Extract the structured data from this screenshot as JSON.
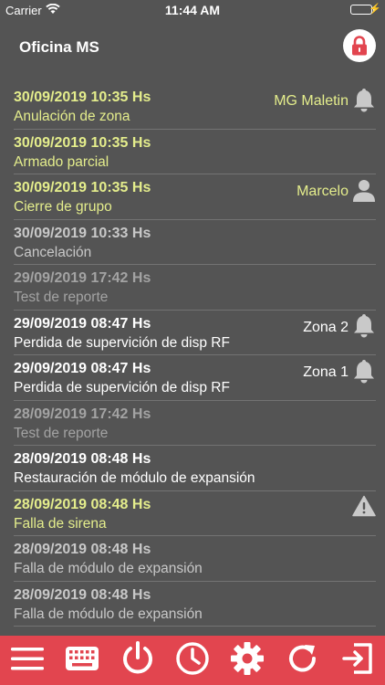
{
  "status": {
    "carrier": "Carrier",
    "time": "11:44 AM",
    "battery_level": 1.0
  },
  "header": {
    "title": "Oficina MS",
    "lock_icon": "lock-icon",
    "lock_color": "#e2454f"
  },
  "colors": {
    "background": "#545454",
    "toolbar": "#e2454f",
    "yellow": "#e4ed8c"
  },
  "events": [
    {
      "date": "30/09/2019 10:35 Hs",
      "desc": "Anulación de zona",
      "color": "yellow",
      "right_label": "MG Maletin",
      "icon": "bell-icon"
    },
    {
      "date": "30/09/2019 10:35 Hs",
      "desc": "Armado parcial",
      "color": "yellow",
      "right_label": "",
      "icon": ""
    },
    {
      "date": "30/09/2019 10:35 Hs",
      "desc": "Cierre de grupo",
      "color": "yellow",
      "right_label": "Marcelo",
      "icon": "person-icon"
    },
    {
      "date": "30/09/2019 10:33 Hs",
      "desc": "Cancelación",
      "color": "lgray",
      "right_label": "",
      "icon": ""
    },
    {
      "date": "29/09/2019 17:42 Hs",
      "desc": "Test de reporte",
      "color": "gray",
      "right_label": "",
      "icon": ""
    },
    {
      "date": "29/09/2019 08:47 Hs",
      "desc": "Perdida de supervición de disp RF",
      "color": "white",
      "right_label": "Zona 2",
      "icon": "bell-icon"
    },
    {
      "date": "29/09/2019 08:47 Hs",
      "desc": "Perdida de supervición de disp RF",
      "color": "white",
      "right_label": "Zona 1",
      "icon": "bell-icon"
    },
    {
      "date": "28/09/2019 17:42 Hs",
      "desc": "Test de reporte",
      "color": "gray",
      "right_label": "",
      "icon": ""
    },
    {
      "date": "28/09/2019 08:48 Hs",
      "desc": "Restauración de módulo de expansión",
      "color": "white",
      "right_label": "",
      "icon": ""
    },
    {
      "date": "28/09/2019 08:48 Hs",
      "desc": "Falla de sirena",
      "color": "yellow",
      "right_label": "",
      "icon": "warning-icon"
    },
    {
      "date": "28/09/2019 08:48 Hs",
      "desc": "Falla de módulo de expansión",
      "color": "lgray",
      "right_label": "",
      "icon": ""
    },
    {
      "date": "28/09/2019 08:48 Hs",
      "desc": "Falla de módulo de expansión",
      "color": "lgray",
      "right_label": "",
      "icon": ""
    }
  ],
  "toolbar": [
    {
      "name": "menu-icon"
    },
    {
      "name": "keyboard-icon"
    },
    {
      "name": "power-icon"
    },
    {
      "name": "clock-icon"
    },
    {
      "name": "gear-icon"
    },
    {
      "name": "refresh-icon"
    },
    {
      "name": "exit-icon"
    }
  ]
}
